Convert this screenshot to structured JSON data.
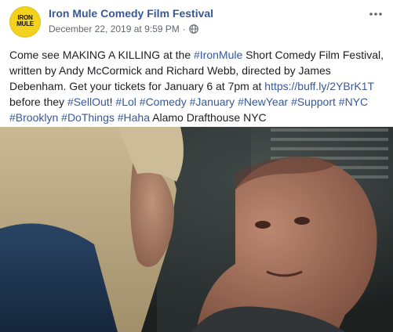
{
  "post": {
    "page_name": "Iron Mule Comedy Film Festival",
    "avatar_text": [
      "IRON",
      "MULE"
    ],
    "timestamp": "December 22, 2019 at 9:59 PM",
    "separator": "·",
    "privacy_icon": "globe-icon",
    "more_icon": "more-options-icon",
    "text": {
      "s1": "Come see MAKING A KILLING at the ",
      "h_ironmule": "#IronMule",
      "s2": " Short Comedy Film Festival, written by Andy McCormick and Richard Webb, directed by James Debenham. Get your tickets for January 6 at 7pm at ",
      "link": "https://buff.ly/2YBrK1T",
      "s3": " before they ",
      "h_sellout": "#SellOut",
      "s4": "! ",
      "h_lol": "#Lol",
      "h_comedy": "#Comedy",
      "h_january": "#January",
      "h_newyear": "#NewYear",
      "h_support": "#Support",
      "h_nyc": "#NYC",
      "h_brooklyn": "#Brooklyn",
      "h_dothings": "#DoThings",
      "h_haha": "#Haha",
      "s5": " Alamo Drafthouse NYC",
      "sp": " "
    },
    "colors": {
      "link": "#385898",
      "text": "#1c1e21",
      "meta": "#616770",
      "avatar_bg": "#f3d21c"
    }
  }
}
